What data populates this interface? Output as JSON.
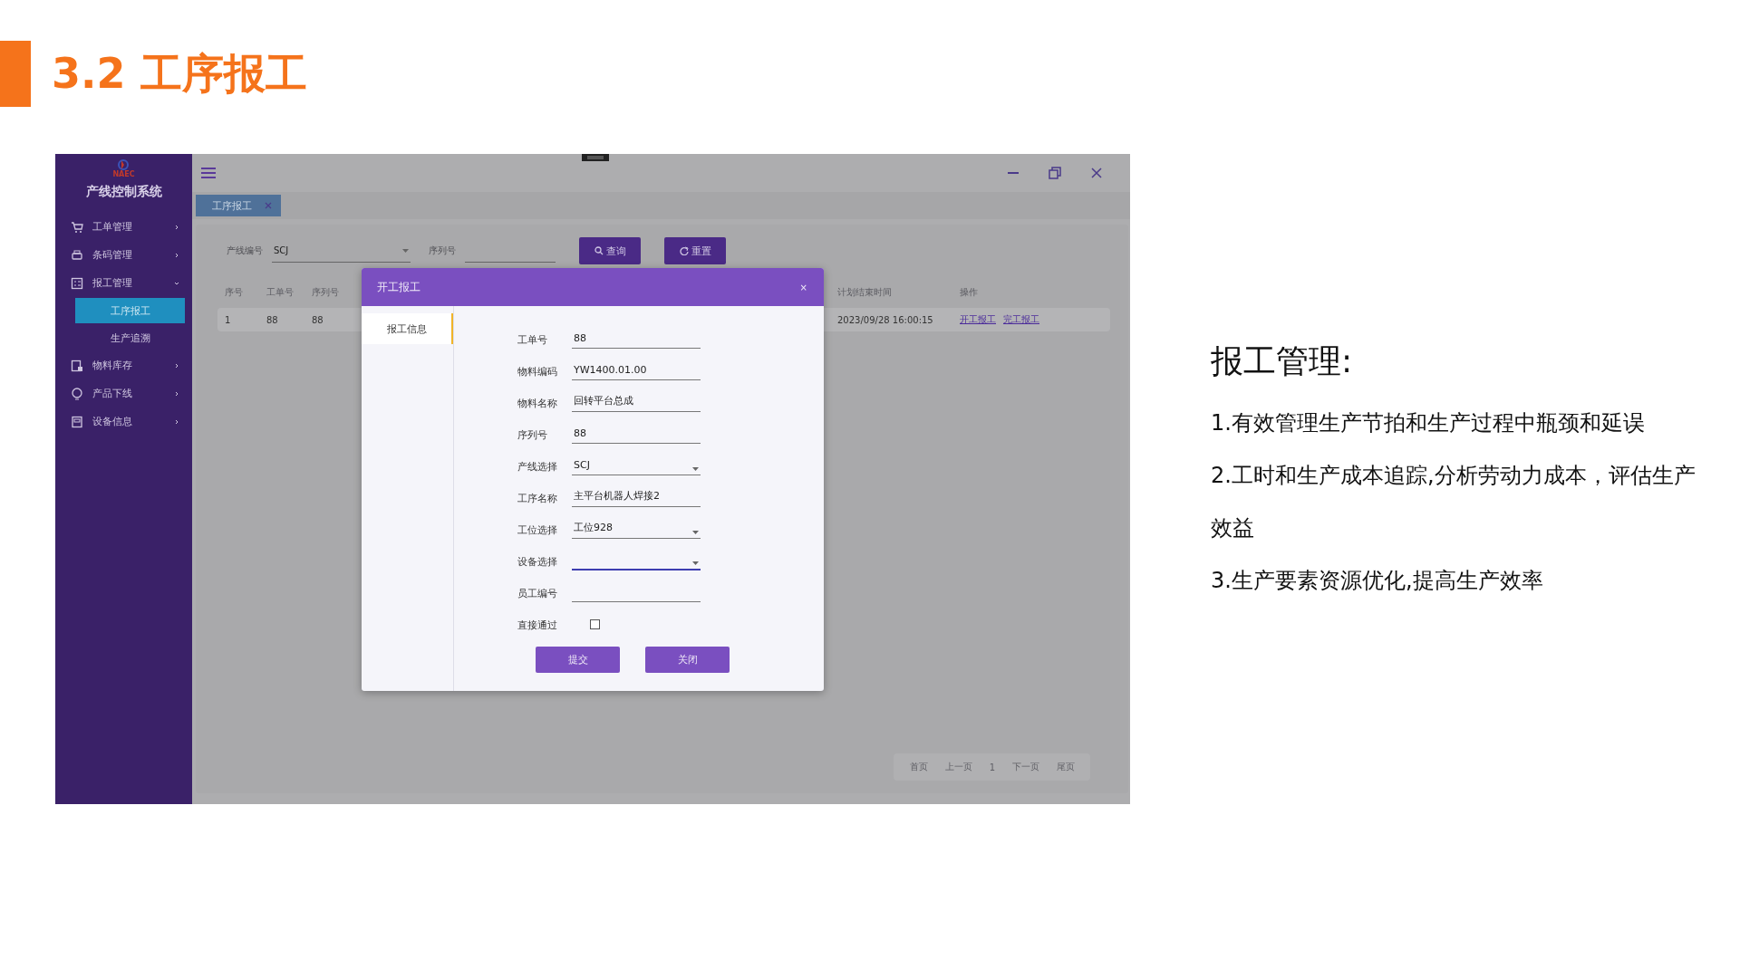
{
  "slide": {
    "title": "3.2 工序报工"
  },
  "app": {
    "logo_text": "NAEC",
    "system_name": "产线控制系统",
    "menu": [
      {
        "label": "工单管理",
        "expanded": false
      },
      {
        "label": "条码管理",
        "expanded": false
      },
      {
        "label": "报工管理",
        "expanded": true,
        "children": [
          {
            "label": "工序报工",
            "selected": true
          },
          {
            "label": "生产追溯",
            "selected": false
          }
        ]
      },
      {
        "label": "物料库存",
        "expanded": false
      },
      {
        "label": "产品下线",
        "expanded": false
      },
      {
        "label": "设备信息",
        "expanded": false
      }
    ],
    "tabs": [
      {
        "label": "工序报工",
        "selected": true
      }
    ],
    "filters": [
      {
        "label": "产线编号",
        "kind": "select",
        "value": "SCJ"
      },
      {
        "label": "序列号",
        "kind": "text"
      }
    ],
    "buttons": [
      "查询",
      "重置"
    ],
    "table": {
      "columns": [
        "序号",
        "工单号",
        "序列号",
        "计划结束时间",
        "操作"
      ],
      "rows": [
        {
          "cells": [
            "1",
            "88",
            "88",
            "2023/09/28 16:00:15"
          ],
          "actions": [
            "开工报工",
            "完工报工"
          ]
        }
      ]
    },
    "pagination": [
      {
        "label": "首页"
      },
      {
        "label": "上一页"
      },
      {
        "label": "1"
      },
      {
        "label": "下一页"
      },
      {
        "label": "尾页"
      }
    ],
    "dialog": {
      "title": "开工报工",
      "close": "×",
      "side_tabs": [
        {
          "label": "报工信息",
          "selected": true
        }
      ],
      "fields": [
        {
          "label": "工单号",
          "kind": "text",
          "value": "88",
          "focused": false
        },
        {
          "label": "物料编码",
          "kind": "text",
          "value": "YW1400.01.00",
          "focused": false
        },
        {
          "label": "物料名称",
          "kind": "text",
          "value": "回转平台总成",
          "focused": false
        },
        {
          "label": "序列号",
          "kind": "text",
          "value": "88",
          "focused": false
        },
        {
          "label": "产线选择",
          "kind": "select",
          "value": "SCJ",
          "focused": false
        },
        {
          "label": "工序名称",
          "kind": "text",
          "value": "主平台机器人焊接2",
          "focused": false
        },
        {
          "label": "工位选择",
          "kind": "select",
          "value": "工位928",
          "focused": false
        },
        {
          "label": "设备选择",
          "kind": "select",
          "focused": true
        },
        {
          "label": "员工编号",
          "kind": "text",
          "focused": false
        },
        {
          "label": "直接通过",
          "kind": "checkbox",
          "checked": false
        }
      ],
      "buttons": [
        "提交",
        "关闭"
      ]
    }
  },
  "notes": {
    "heading": "报工管理:",
    "points": [
      "1.有效管理生产节拍和生产过程中瓶颈和延误",
      "2.工时和生产成本追踪,分析劳动力成本，评估生产效益",
      "3.生产要素资源优化,提高生产效率"
    ]
  }
}
